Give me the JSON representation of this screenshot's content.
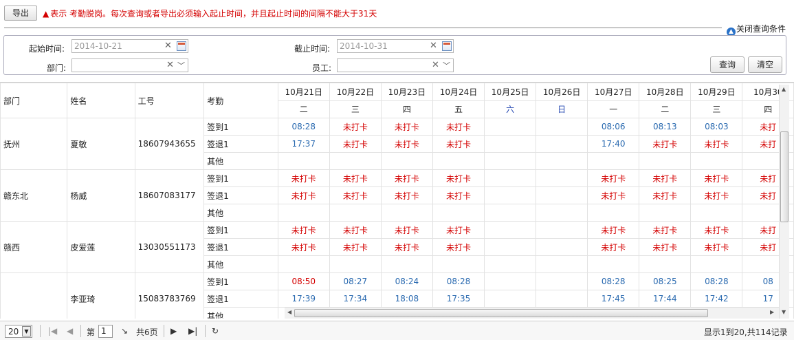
{
  "toolbar": {
    "export_label": "导出"
  },
  "notice": {
    "symbol": "▲",
    "text": "表示 考勤脱岗。每次查询或者导出必须输入起止时间，并且起止时间的间隔不能大于31天"
  },
  "query_toggle": {
    "label": "关闭查询条件",
    "icon": "up-circle-icon"
  },
  "query": {
    "start_label": "起始时间:",
    "start_value": "2014-10-21",
    "end_label": "截止时间:",
    "end_value": "2014-10-31",
    "dept_label": "部门:",
    "dept_value": "",
    "staff_label": "员工:",
    "staff_value": "",
    "search_label": "查询",
    "clear_label": "清空"
  },
  "grid": {
    "columns": {
      "dept": "部门",
      "name": "姓名",
      "id": "工号",
      "attendance": "考勤"
    },
    "dates": [
      {
        "date": "10月21日",
        "weekday": "二"
      },
      {
        "date": "10月22日",
        "weekday": "三"
      },
      {
        "date": "10月23日",
        "weekday": "四"
      },
      {
        "date": "10月24日",
        "weekday": "五"
      },
      {
        "date": "10月25日",
        "weekday": "六"
      },
      {
        "date": "10月26日",
        "weekday": "日"
      },
      {
        "date": "10月27日",
        "weekday": "一"
      },
      {
        "date": "10月28日",
        "weekday": "二"
      },
      {
        "date": "10月29日",
        "weekday": "三"
      },
      {
        "date": "10月30",
        "weekday": "四"
      }
    ],
    "employees": [
      {
        "dept": "抚州",
        "name": "夏敏",
        "id": "18607943655",
        "rows": [
          {
            "label": "签到1",
            "cells": [
              "08:28",
              "未打卡",
              "未打卡",
              "未打卡",
              "",
              "",
              "08:06",
              "08:13",
              "08:03",
              "未打"
            ]
          },
          {
            "label": "签退1",
            "cells": [
              "17:37",
              "未打卡",
              "未打卡",
              "未打卡",
              "",
              "",
              "17:40",
              "未打卡",
              "未打卡",
              "未打"
            ]
          },
          {
            "label": "其他",
            "cells": [
              "",
              "",
              "",
              "",
              "",
              "",
              "",
              "",
              "",
              ""
            ]
          }
        ]
      },
      {
        "dept": "赣东北",
        "name": "杨威",
        "id": "18607083177",
        "rows": [
          {
            "label": "签到1",
            "cells": [
              "未打卡",
              "未打卡",
              "未打卡",
              "未打卡",
              "",
              "",
              "未打卡",
              "未打卡",
              "未打卡",
              "未打"
            ]
          },
          {
            "label": "签退1",
            "cells": [
              "未打卡",
              "未打卡",
              "未打卡",
              "未打卡",
              "",
              "",
              "未打卡",
              "未打卡",
              "未打卡",
              "未打"
            ]
          },
          {
            "label": "其他",
            "cells": [
              "",
              "",
              "",
              "",
              "",
              "",
              "",
              "",
              "",
              ""
            ]
          }
        ]
      },
      {
        "dept": "赣西",
        "name": "皮爱莲",
        "id": "13030551173",
        "rows": [
          {
            "label": "签到1",
            "cells": [
              "未打卡",
              "未打卡",
              "未打卡",
              "未打卡",
              "",
              "",
              "未打卡",
              "未打卡",
              "未打卡",
              "未打"
            ]
          },
          {
            "label": "签退1",
            "cells": [
              "未打卡",
              "未打卡",
              "未打卡",
              "未打卡",
              "",
              "",
              "未打卡",
              "未打卡",
              "未打卡",
              "未打"
            ]
          },
          {
            "label": "其他",
            "cells": [
              "",
              "",
              "",
              "",
              "",
              "",
              "",
              "",
              "",
              ""
            ]
          }
        ]
      },
      {
        "dept": "",
        "name": "李亚琦",
        "id": "15083783769",
        "rows": [
          {
            "label": "签到1",
            "cells": [
              "08:50",
              "08:27",
              "08:24",
              "08:28",
              "",
              "",
              "08:28",
              "08:25",
              "08:28",
              "08"
            ]
          },
          {
            "label": "签退1",
            "cells": [
              "17:39",
              "17:34",
              "18:08",
              "17:35",
              "",
              "",
              "17:45",
              "17:44",
              "17:42",
              "17"
            ]
          },
          {
            "label": "其他",
            "cells": [
              "",
              "",
              "",
              "",
              "",
              "",
              "",
              "",
              "",
              ""
            ]
          }
        ]
      }
    ],
    "late_color": "#d40000",
    "normal_color": "#2a6ab0",
    "weekend_color": "#1a3fae"
  },
  "pager": {
    "page_size": "20",
    "page_prefix": "第",
    "page_value": "1",
    "total_pages": "共6页",
    "summary": "显示1到20,共114记录"
  }
}
